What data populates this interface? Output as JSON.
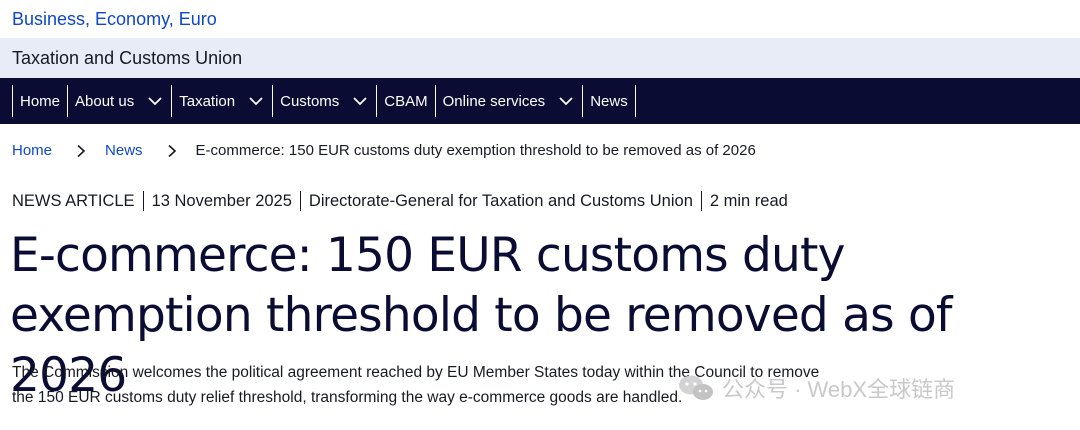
{
  "site": {
    "title": "Business, Economy, Euro"
  },
  "subsite": {
    "title": "Taxation and Customs Union"
  },
  "nav": {
    "items": [
      {
        "label": "Home",
        "has_dropdown": false
      },
      {
        "label": "About us",
        "has_dropdown": true
      },
      {
        "label": "Taxation",
        "has_dropdown": true
      },
      {
        "label": "Customs",
        "has_dropdown": true
      },
      {
        "label": "CBAM",
        "has_dropdown": false
      },
      {
        "label": "Online services",
        "has_dropdown": true
      },
      {
        "label": "News",
        "has_dropdown": false
      }
    ]
  },
  "breadcrumb": {
    "items": [
      "Home",
      "News",
      "E-commerce: 150 EUR customs duty exemption threshold to be removed as of 2026"
    ]
  },
  "meta": {
    "type": "NEWS ARTICLE",
    "date": "13 November 2025",
    "author": "Directorate-General for Taxation and Customs Union",
    "read_time": "2 min read"
  },
  "article": {
    "title": "E-commerce: 150 EUR customs duty exemption threshold to be removed as of 2026",
    "lead": "The Commission welcomes the political agreement reached by EU Member States today within the Council to remove the 150 EUR customs duty relief threshold, transforming the way e-commerce goods are handled."
  },
  "watermark": {
    "text": "公众号 · WebX全球链商",
    "icon": "wechat-logo-icon"
  },
  "colors": {
    "link": "#0e47cb",
    "nav_bg": "#0a0c34",
    "subsite_bg": "#e7ecf6",
    "text": "#171a22"
  }
}
